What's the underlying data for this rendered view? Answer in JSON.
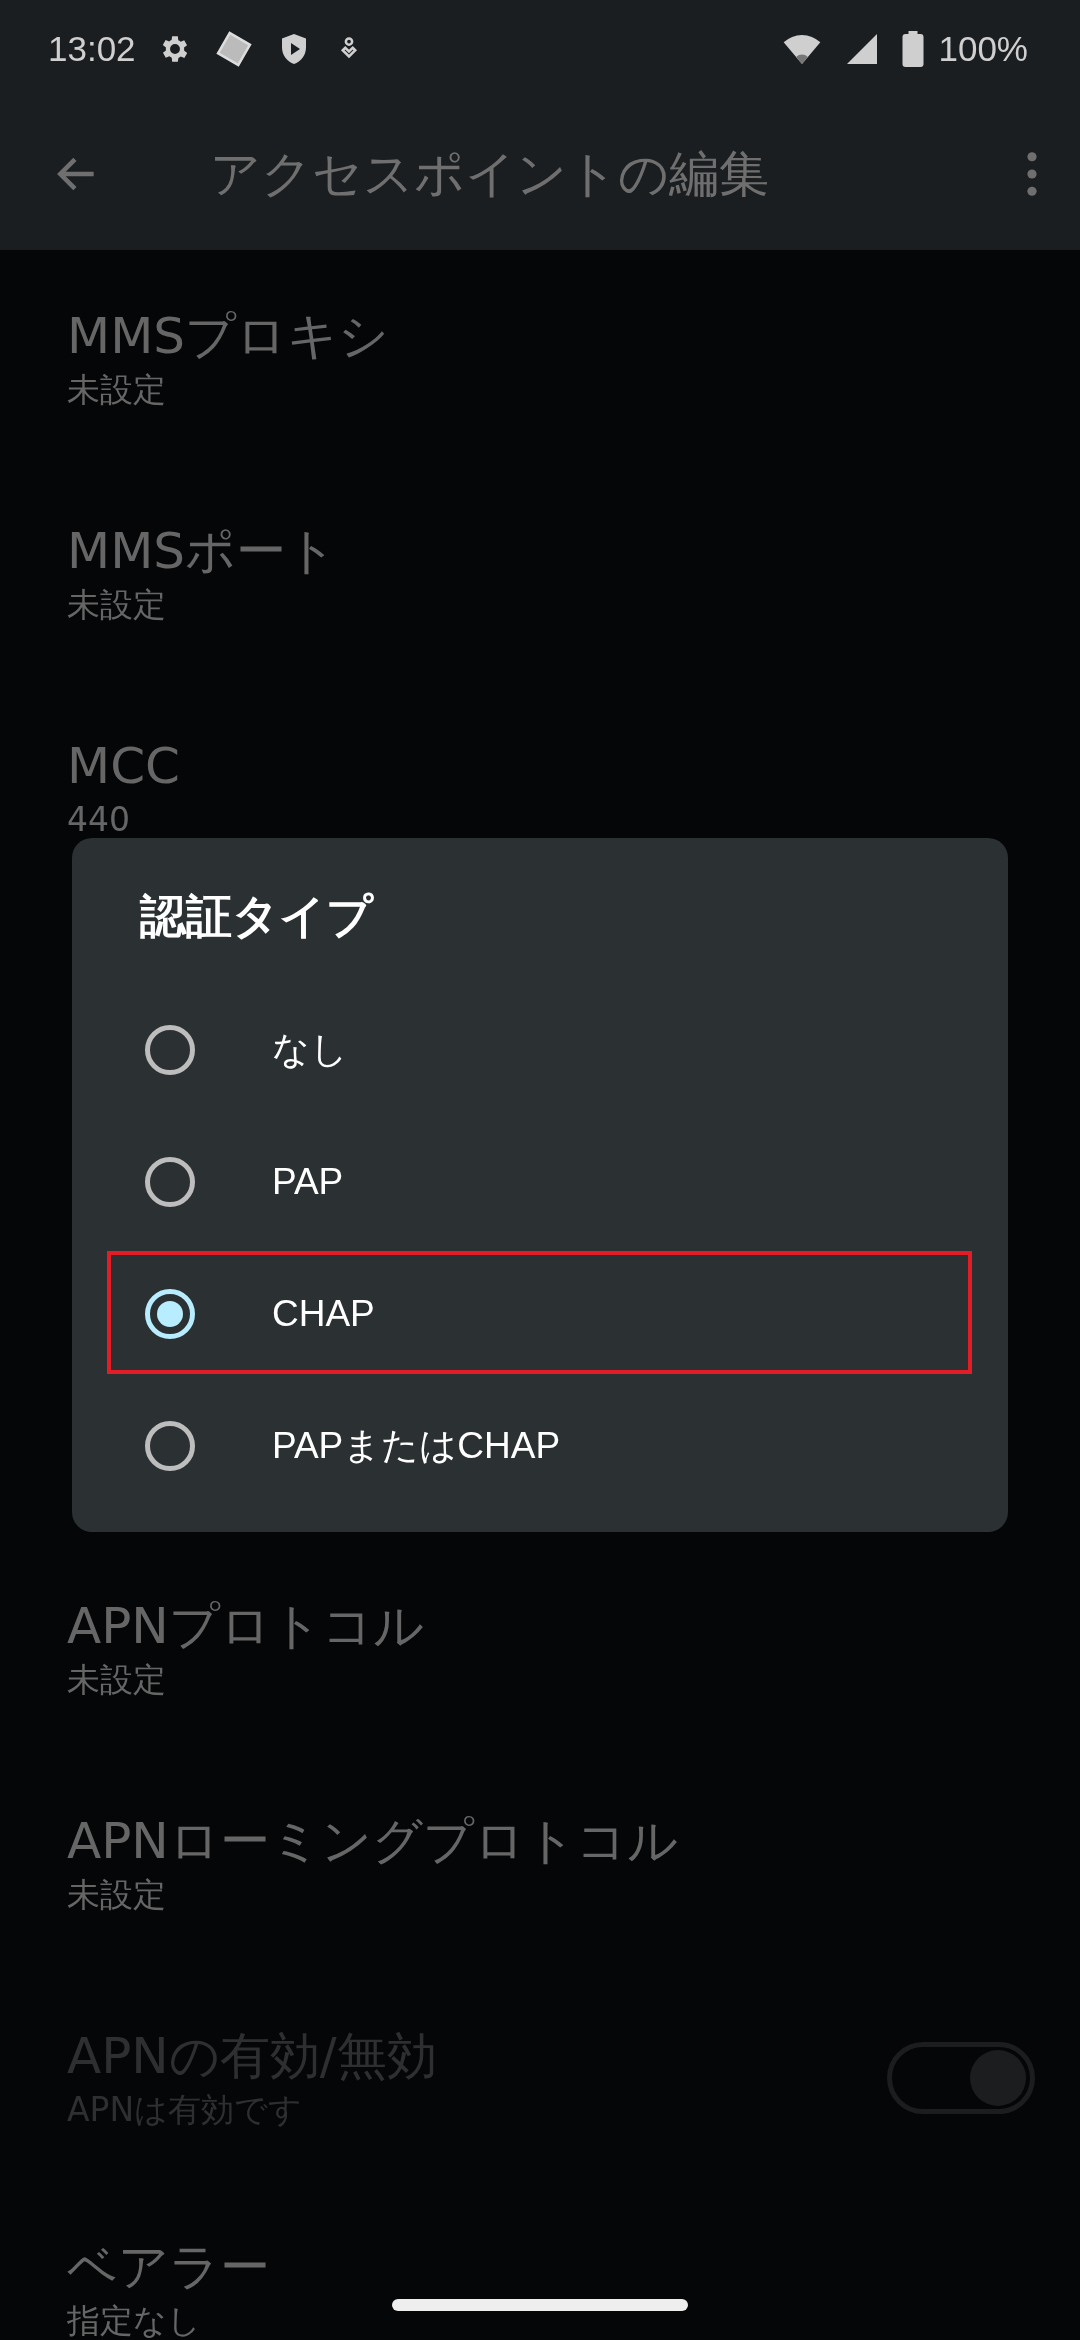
{
  "status_bar": {
    "time": "13:02",
    "battery": "100%"
  },
  "app_bar": {
    "title": "アクセスポイントの編集"
  },
  "settings_top": [
    {
      "title": "MMSプロキシ",
      "summary": "未設定"
    },
    {
      "title": "MMSポート",
      "summary": "未設定"
    },
    {
      "title": "MCC",
      "summary": "440"
    }
  ],
  "settings_bottom": [
    {
      "kind": "text",
      "title": "APNプロトコル",
      "summary": "未設定",
      "disabled": false
    },
    {
      "kind": "text",
      "title": "APNローミングプロトコル",
      "summary": "未設定",
      "disabled": false
    },
    {
      "kind": "switch",
      "title": "APNの有効/無効",
      "summary": "APNは有効です",
      "disabled": true,
      "on": true
    },
    {
      "kind": "text",
      "title": "ベアラー",
      "summary": "指定なし",
      "disabled": false
    }
  ],
  "dialog": {
    "title": "認証タイプ",
    "options": [
      {
        "label": "なし",
        "selected": false,
        "highlighted": false
      },
      {
        "label": "PAP",
        "selected": false,
        "highlighted": false
      },
      {
        "label": "CHAP",
        "selected": true,
        "highlighted": true
      },
      {
        "label": "PAPまたはCHAP",
        "selected": false,
        "highlighted": false
      }
    ]
  }
}
